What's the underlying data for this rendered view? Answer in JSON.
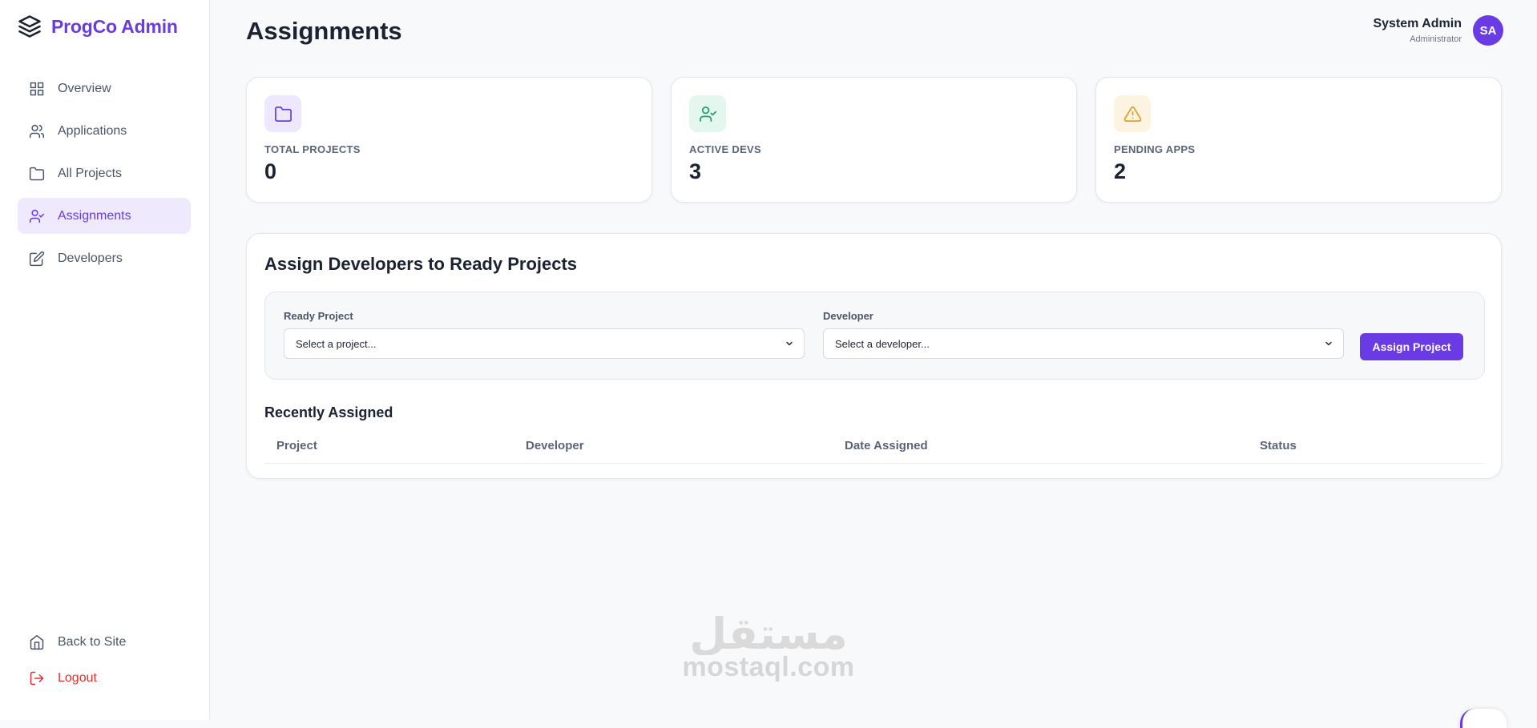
{
  "brand": {
    "name": "ProgCo Admin"
  },
  "sidebar": {
    "items": [
      {
        "label": "Overview",
        "icon": "grid-icon"
      },
      {
        "label": "Applications",
        "icon": "users-icon"
      },
      {
        "label": "All Projects",
        "icon": "folder-icon"
      },
      {
        "label": "Assignments",
        "icon": "user-check-icon",
        "active": true
      },
      {
        "label": "Developers",
        "icon": "edit-icon"
      }
    ],
    "bottom": [
      {
        "label": "Back to Site",
        "icon": "home-icon"
      },
      {
        "label": "Logout",
        "icon": "logout-icon"
      }
    ]
  },
  "header": {
    "title": "Assignments",
    "user": {
      "name": "System Admin",
      "role": "Administrator",
      "initials": "SA"
    }
  },
  "stats": [
    {
      "label": "TOTAL PROJECTS",
      "value": "0",
      "icon": "folder-icon",
      "color": "#6a3be4",
      "bg": "#ede8fd"
    },
    {
      "label": "ACTIVE DEVS",
      "value": "3",
      "icon": "user-check-icon",
      "color": "#1aa36f",
      "bg": "#e3f7ee"
    },
    {
      "label": "PENDING APPS",
      "value": "2",
      "icon": "alert-triangle-icon",
      "color": "#e0a020",
      "bg": "#fdf3e1"
    }
  ],
  "assign": {
    "title": "Assign Developers to Ready Projects",
    "project_label": "Ready Project",
    "project_value": "Select a project...",
    "developer_label": "Developer",
    "developer_value": "Select a developer...",
    "button": "Assign Project"
  },
  "recent": {
    "title": "Recently Assigned",
    "columns": [
      "Project",
      "Developer",
      "Date Assigned",
      "Status"
    ],
    "rows": []
  },
  "watermark": {
    "text": "mostaql.com",
    "logo_text": "مستقل"
  },
  "colors": {
    "accent": "#6a3be4",
    "danger": "#e5302d",
    "background": "#f8f9fb"
  }
}
